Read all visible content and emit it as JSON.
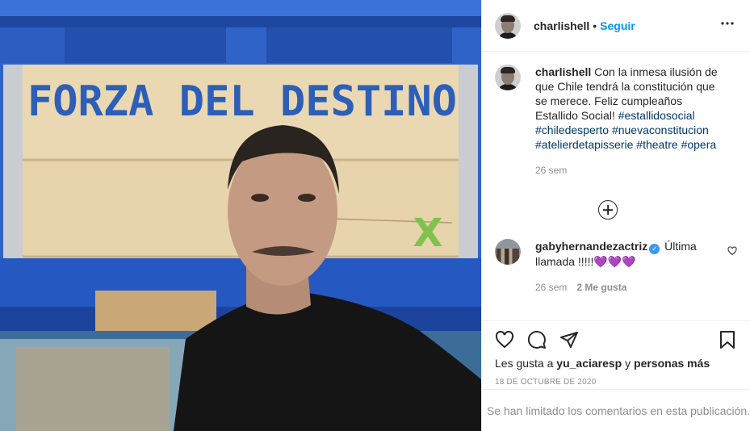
{
  "photo": {
    "crate_text": "FORZA DEL DESTINO",
    "crate_mark": "X"
  },
  "header": {
    "username": "charlishell",
    "separator": "•",
    "follow_label": "Seguir",
    "more_icon": "more-horizontal-icon"
  },
  "caption": {
    "username": "charlishell",
    "text_parts": [
      "Con la inmesa ilusión de que Chile tendrá la constitución que se merece. Feliz cumpleaños Estallido Social! "
    ],
    "hashtags": [
      "#estallidosocial",
      "#chiledesperto",
      "#nuevaconstitucion",
      "#atelierdetapisserie",
      "#theatre",
      "#opera"
    ],
    "time": "26 sem"
  },
  "load_more": {
    "icon": "plus-circle-icon"
  },
  "comment": {
    "username": "gabyhernandezactriz",
    "text": "Última llamada !!!!!",
    "hearts": "💜💜💜",
    "time": "26 sem",
    "likes": "2 Me gusta"
  },
  "actions": {
    "like_icon": "heart-icon",
    "comment_icon": "comment-icon",
    "share_icon": "share-icon",
    "save_icon": "bookmark-icon"
  },
  "likes_line": {
    "prefix": "Les gusta a ",
    "user": "yu_aciaresp",
    "middle": " y ",
    "others": "personas más"
  },
  "date": "18 de octubre de 2020",
  "comments_limited": "Se han limitado los comentarios en esta publicación."
}
